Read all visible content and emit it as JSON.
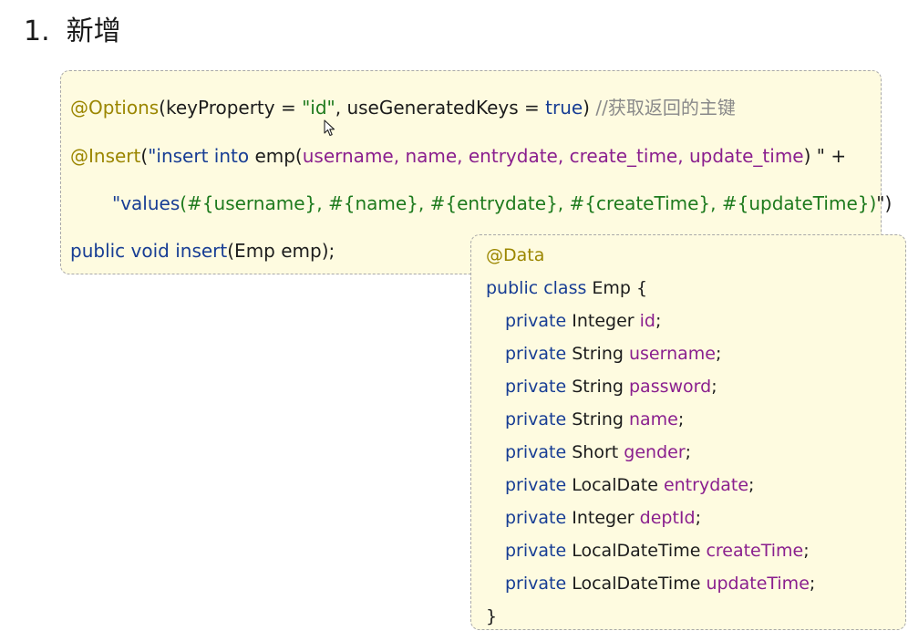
{
  "heading": {
    "number": "1.",
    "title": "新增"
  },
  "mapper_code": {
    "line1": {
      "annotation": "@Options",
      "open": "(keyProperty = ",
      "id_string": "\"id\"",
      "middle": ", useGeneratedKeys = ",
      "true_keyword": "true",
      "close": ")",
      "comment": "//获取返回的主键"
    },
    "line2": {
      "annotation": "@Insert",
      "open": "(",
      "sql_start": "\"insert into ",
      "table": "emp(",
      "columns": "username, name, entrydate, create_time, update_time",
      "sql_end": ") \"",
      "plus": " +"
    },
    "line3": {
      "values_kw": "\"values",
      "values_body": "(#{username}, #{name}, #{entrydate}, #{createTime}, #{updateTime})",
      "end_quote": "\"",
      "close": ")"
    },
    "line4": {
      "public_void": "public void",
      "method": "insert",
      "params": "(Emp emp);"
    }
  },
  "entity_code": {
    "annotation": "@Data",
    "class_decl": {
      "keywords": "public class",
      "name": "Emp {"
    },
    "fields": [
      {
        "modifier": "private",
        "type": "Integer",
        "name": "id"
      },
      {
        "modifier": "private",
        "type": "String",
        "name": "username"
      },
      {
        "modifier": "private",
        "type": "String",
        "name": "password"
      },
      {
        "modifier": "private",
        "type": "String",
        "name": "name"
      },
      {
        "modifier": "private",
        "type": "Short",
        "name": "gender"
      },
      {
        "modifier": "private",
        "type": "LocalDate",
        "name": "entrydate"
      },
      {
        "modifier": "private",
        "type": "Integer",
        "name": "deptId"
      },
      {
        "modifier": "private",
        "type": "LocalDateTime",
        "name": "createTime"
      },
      {
        "modifier": "private",
        "type": "LocalDateTime",
        "name": "updateTime"
      }
    ],
    "semicolon": ";",
    "closing_brace": "}"
  },
  "colors": {
    "annotation": "#9b8600",
    "keyword": "#173d94",
    "string": "#1d7a1d",
    "field": "#8a1f8e",
    "comment": "#8a8a8a",
    "panel_background": "#fefbe0"
  }
}
